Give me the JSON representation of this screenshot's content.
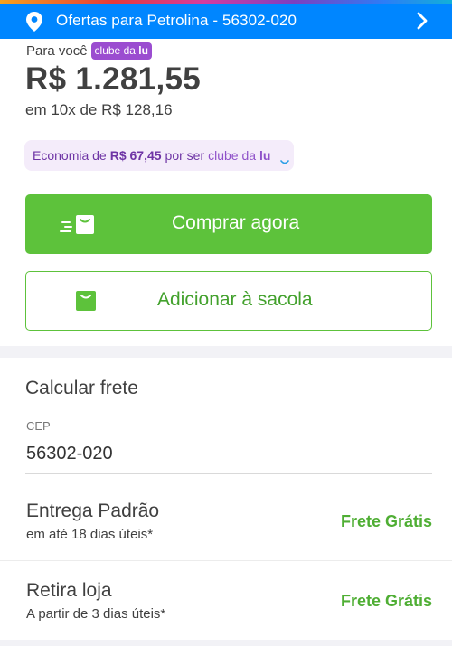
{
  "header": {
    "location_text": "Ofertas para Petrolina - 56302-020",
    "icons": [
      "location-pin-icon",
      "chevron-right-icon"
    ],
    "background_color": "#0086ff"
  },
  "price": {
    "para_voce": "Para você",
    "clube_prefix": "clube da ",
    "clube_suffix": "lu",
    "price": "R$ 1.281,55",
    "installments": "em 10x de R$ 128,16"
  },
  "economy": {
    "prefix": "Economia de",
    "amount": "R$ 67,45",
    "suffix": "por ser",
    "clube_prefix": "clube da ",
    "clube_suffix": "lu"
  },
  "actions": {
    "buy_label": "Comprar agora",
    "bag_label": "Adicionar à sacola",
    "buy_color": "#5dc23b"
  },
  "shipping": {
    "title": "Calcular frete",
    "cep_label": "CEP",
    "cep_value": "56302-020",
    "options": [
      {
        "title": "Entrega Padrão",
        "subtitle": "em até 18 dias úteis*",
        "price": "Frete Grátis"
      },
      {
        "title": "Retira loja",
        "subtitle": "A partir de 3 dias úteis*",
        "price": "Frete Grátis"
      }
    ]
  }
}
